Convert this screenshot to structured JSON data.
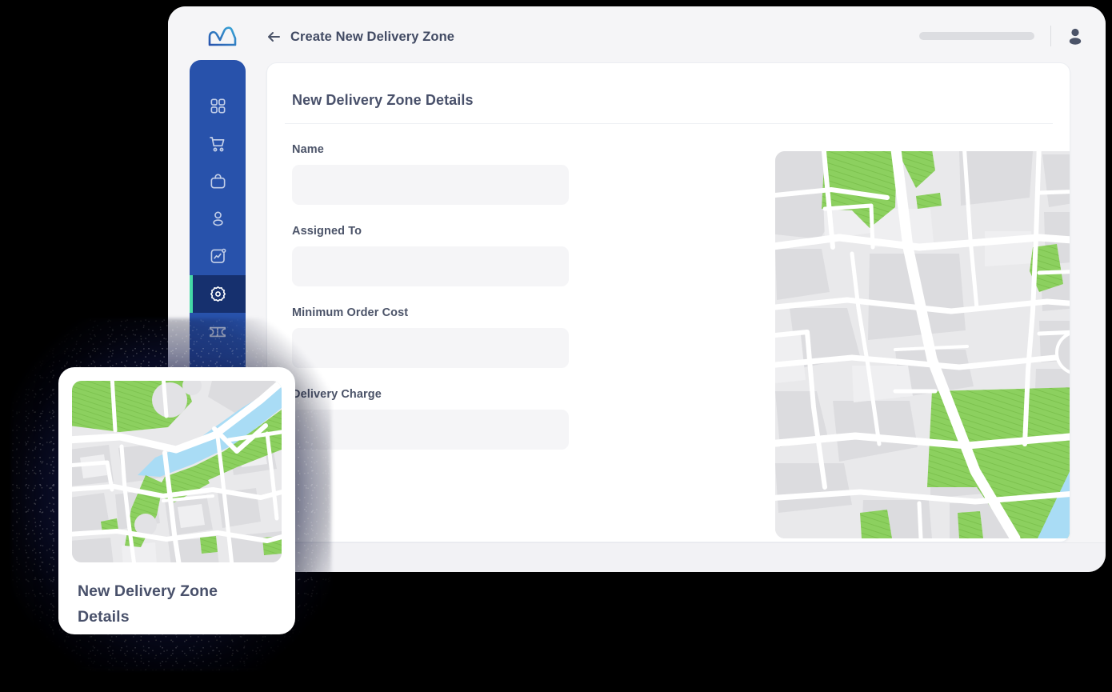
{
  "app": {
    "background_color": "#000000",
    "window_bg": "#f5f5f7",
    "accent_blue": "#2852ab",
    "accent_green": "#44d9a6",
    "active_nav_bg": "#16306e"
  },
  "header": {
    "logo_name": "brand-logo-icon",
    "back_icon": "back-arrow-icon",
    "title": "Create New Delivery Zone",
    "search_placeholder": "",
    "avatar_icon": "user-avatar-icon"
  },
  "sidebar": {
    "items": [
      {
        "id": "dashboard",
        "icon": "grid-dashboard-icon",
        "active": false
      },
      {
        "id": "orders",
        "icon": "shopping-cart-icon",
        "active": false
      },
      {
        "id": "products",
        "icon": "shopping-bag-icon",
        "active": false
      },
      {
        "id": "customers",
        "icon": "user-icon",
        "active": false
      },
      {
        "id": "reports",
        "icon": "chart-square-icon",
        "active": false
      },
      {
        "id": "settings",
        "icon": "gear-icon",
        "active": true
      },
      {
        "id": "coupons",
        "icon": "ticket-icon",
        "active": false
      }
    ]
  },
  "main": {
    "card_title": "New Delivery Zone Details",
    "fields": [
      {
        "label": "Name",
        "value": "",
        "placeholder": ""
      },
      {
        "label": "Assigned To",
        "value": "",
        "placeholder": ""
      },
      {
        "label": "Minimum Order Cost",
        "value": "",
        "placeholder": ""
      },
      {
        "label": "Delivery Charge",
        "value": "",
        "placeholder": ""
      }
    ],
    "map": {
      "name": "delivery-zone-map",
      "land_color": "#e8e8ea",
      "block_color": "#dedee1",
      "road_color": "#ffffff",
      "park_color": "#8cd05f",
      "water_color": "#a9dcf5"
    }
  },
  "floating_card": {
    "thumbnail_name": "delivery-zone-map-thumbnail",
    "title": "New Delivery Zone Details"
  }
}
